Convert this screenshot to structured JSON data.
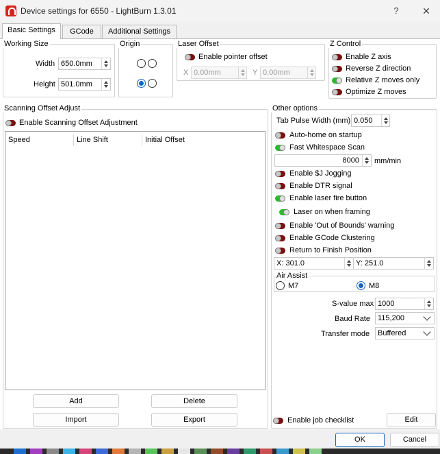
{
  "window": {
    "title": "Device settings for 6550 - LightBurn 1.3.01",
    "help": "?",
    "close": "✕"
  },
  "tabs": [
    {
      "label": "Basic Settings",
      "active": true
    },
    {
      "label": "GCode",
      "active": false
    },
    {
      "label": "Additional Settings",
      "active": false
    }
  ],
  "working_size": {
    "title": "Working Size",
    "width_label": "Width",
    "width_value": "650.0mm",
    "height_label": "Height",
    "height_value": "501.0mm"
  },
  "origin": {
    "title": "Origin",
    "selected": "bottom-left"
  },
  "laser_offset": {
    "title": "Laser Offset",
    "enable_label": "Enable pointer offset",
    "enabled": false,
    "x_label": "X",
    "x_value": "0.00mm",
    "y_label": "Y",
    "y_value": "0.00mm"
  },
  "z_control": {
    "title": "Z Control",
    "items": [
      {
        "label": "Enable Z axis",
        "on": false
      },
      {
        "label": "Reverse Z direction",
        "on": false
      },
      {
        "label": "Relative Z moves only",
        "on": true
      },
      {
        "label": "Optimize Z moves",
        "on": false
      }
    ]
  },
  "scanning": {
    "title": "Scanning Offset Adjust",
    "enable_label": "Enable Scanning Offset Adjustment",
    "enabled": false,
    "columns": [
      "Speed",
      "Line Shift",
      "Initial Offset"
    ],
    "add": "Add",
    "delete": "Delete",
    "import": "Import",
    "export": "Export"
  },
  "other": {
    "title": "Other options",
    "tab_pulse_label": "Tab Pulse Width (mm)",
    "tab_pulse_value": "0.050",
    "auto_home": {
      "label": "Auto-home on startup",
      "on": false
    },
    "fast_whitespace": {
      "label": "Fast Whitespace Scan",
      "on": true
    },
    "speed_value": "8000",
    "speed_unit": "mm/min",
    "toggles": [
      {
        "label": "Enable $J Jogging",
        "on": false
      },
      {
        "label": "Enable DTR signal",
        "on": false
      },
      {
        "label": "Enable laser fire button",
        "on": true
      },
      {
        "label": "Laser on when framing",
        "on": true
      },
      {
        "label": "Enable 'Out of Bounds' warning",
        "on": false
      },
      {
        "label": "Enable GCode Clustering",
        "on": false
      },
      {
        "label": "Return to Finish Position",
        "on": false
      }
    ],
    "x_label": "X:",
    "x_value": "301.0",
    "y_label": "Y:",
    "y_value": "251.0",
    "air_assist": {
      "title": "Air Assist",
      "m7": "M7",
      "m8": "M8",
      "selected": "M8"
    },
    "s_value_label": "S-value max",
    "s_value": "1000",
    "baud_label": "Baud Rate",
    "baud_value": "115,200",
    "transfer_label": "Transfer mode",
    "transfer_value": "Buffered",
    "job_checklist": {
      "label": "Enable job checklist",
      "on": false
    },
    "edit": "Edit"
  },
  "footer": {
    "ok": "OK",
    "cancel": "Cancel"
  },
  "colors": {
    "toggle_off": "#7a1010",
    "toggle_on": "#2db82d",
    "accent": "#1565c0"
  }
}
